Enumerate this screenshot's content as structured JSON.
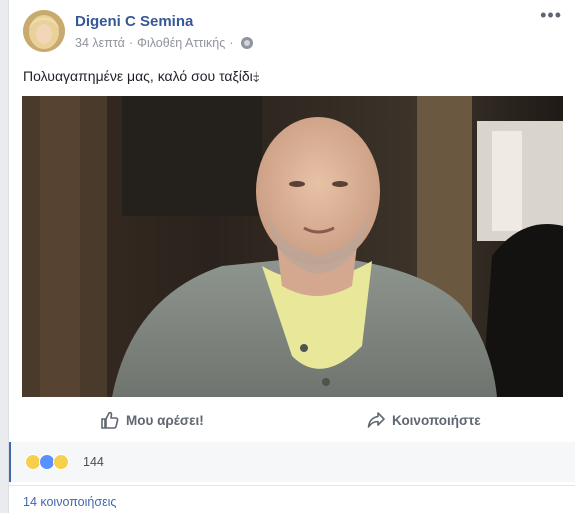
{
  "post": {
    "author": "Digeni C Semina",
    "time": "34 λεπτά",
    "separator": "·",
    "location": "Φιλοθέη Αττικής",
    "location_separator": "·",
    "text": "Πολυαγαπημένε μας, καλό σου ταξίδι⤈",
    "more_icon": "more-options-icon"
  },
  "actions": {
    "like_label": "Μου αρέσει!",
    "share_label": "Κοινοποιήστε"
  },
  "reactions": {
    "types": [
      "sad",
      "like",
      "wow"
    ],
    "count": "144"
  },
  "shares": {
    "label": "14 κοινοποιήσεις"
  },
  "colors": {
    "author_link": "#365899",
    "meta": "#90949c",
    "accent": "#4267b2",
    "background": "#e9ebee"
  }
}
